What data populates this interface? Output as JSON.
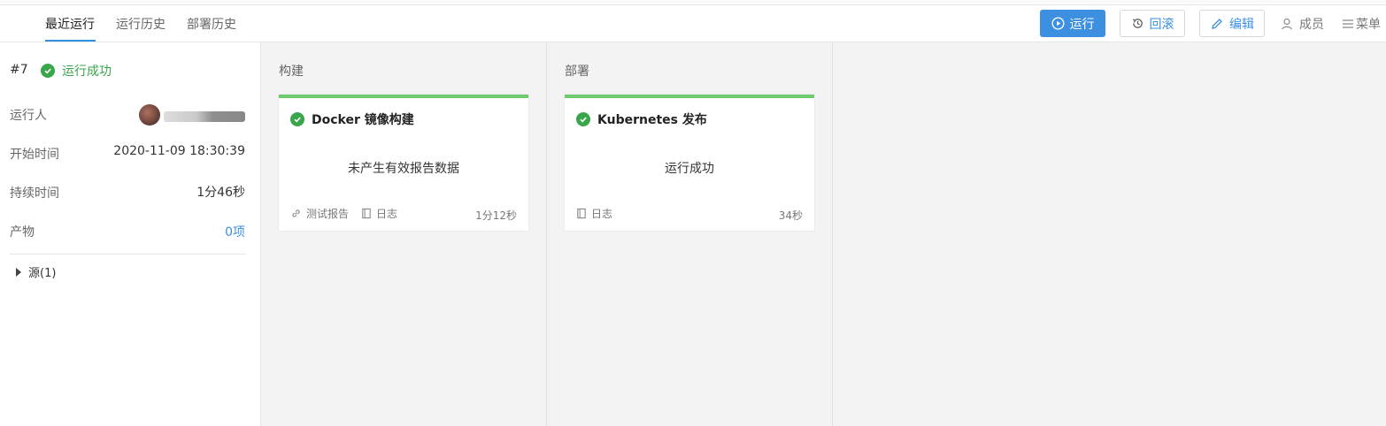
{
  "tabs": [
    "最近运行",
    "运行历史",
    "部署历史"
  ],
  "toolbar": {
    "run": "运行",
    "rollback": "回滚",
    "edit": "编辑",
    "members": "成员",
    "menu": "菜单"
  },
  "run": {
    "number": "#7",
    "status": "运行成功",
    "runner_label": "运行人",
    "start_label": "开始时间",
    "start_value": "2020-11-09 18:30:39",
    "duration_label": "持续时间",
    "duration_value": "1分46秒",
    "artifacts_label": "产物",
    "artifacts_value": "0项",
    "source_label": "源(1)"
  },
  "stages": [
    {
      "title": "构建",
      "job": {
        "name": "Docker 镜像构建",
        "message": "未产生有效报告数据",
        "links": [
          "测试报告",
          "日志"
        ],
        "duration": "1分12秒"
      }
    },
    {
      "title": "部署",
      "job": {
        "name": "Kubernetes 发布",
        "message": "运行成功",
        "links": [
          "日志"
        ],
        "duration": "34秒"
      }
    }
  ],
  "colors": {
    "accent": "#3d8fe0",
    "success": "#3aa64c",
    "stage_bar": "#6fcb6f"
  }
}
